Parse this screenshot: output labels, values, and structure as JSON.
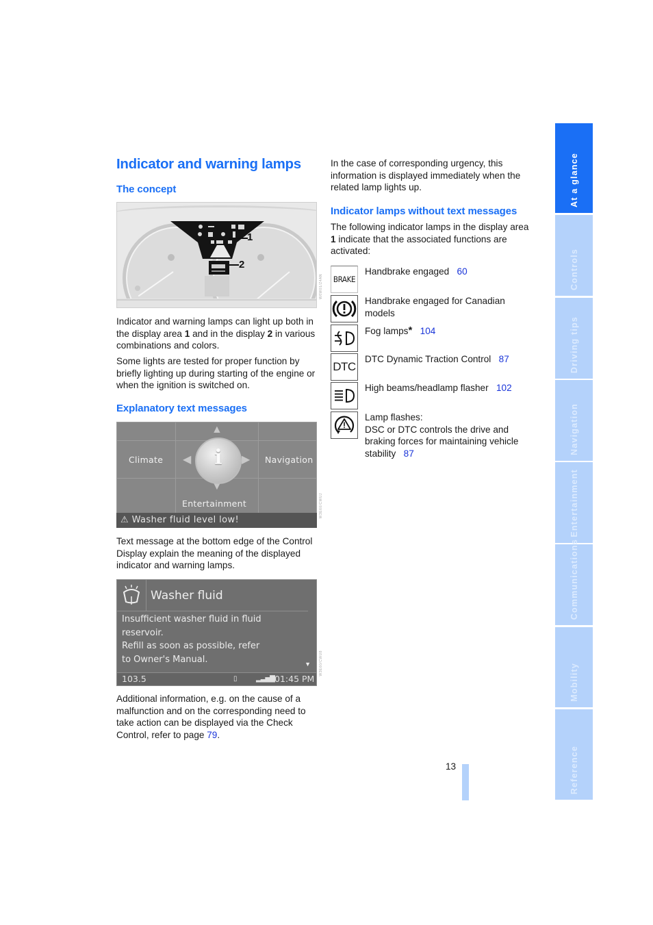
{
  "page": {
    "title": "Indicator and warning lamps",
    "page_number": "13",
    "accent_color": "#1a6ff5",
    "link_color": "#1a35d9",
    "tab_color_inactive": "#b4d2fb"
  },
  "left_column": {
    "concept_heading": "The concept",
    "cluster_figure": {
      "callout_1": "1",
      "callout_2": "2",
      "image_code": "W6W01/Z4AN"
    },
    "para1": {
      "part1": "Indicator and warning lamps can light up both in the display area ",
      "bold1": "1",
      "part2": " and in the display ",
      "bold2": "2",
      "part3": " in various combinations and colors."
    },
    "para2": "Some lights are tested for proper function by briefly lighting up during starting of the engine or when the ignition is switched on.",
    "explanatory_heading": "Explanatory text messages",
    "menu_figure": {
      "items": {
        "left": "Climate",
        "right": "Navigation",
        "bottom": "Entertainment"
      },
      "center_icon": "info-icon",
      "warning_message": "Washer fluid level low!",
      "image_code": "W3E60/CWUJ"
    },
    "para3": "Text message at the bottom edge of the Control Display explain the meaning of the displayed indicator and warning lamps.",
    "washer_figure": {
      "title": "Washer fluid",
      "lines": [
        "Insufficient washer fluid in fluid",
        "reservoir.",
        "Refill as soon as possible, refer",
        "to Owner's Manual."
      ],
      "status_frequency": "103.5",
      "status_time": "01:45 PM",
      "image_code": "W3E60/CWU8"
    },
    "para4": {
      "text": "Additional information, e.g. on the cause of a malfunction and on the corresponding need to take action can be displayed via the Check Control, refer to page ",
      "link": "79",
      "end": "."
    }
  },
  "right_column": {
    "para_urgency": "In the case of corresponding urgency, this information is displayed immediately when the related lamp lights up.",
    "indicator_heading": "Indicator lamps without text messages",
    "intro": {
      "part1": "The following indicator lamps in the display area ",
      "bold": "1",
      "part2": " indicate that the associated functions are activated:"
    },
    "indicators": [
      {
        "icon": "brake-text-icon",
        "icon_text": "BRAKE",
        "label": "Handbrake engaged",
        "page": "60"
      },
      {
        "icon": "handbrake-canada-icon",
        "label": "Handbrake engaged for Canadian models",
        "page": ""
      },
      {
        "icon": "fog-lamp-icon",
        "label": "Fog lamps",
        "asterisk": "*",
        "page": "104"
      },
      {
        "icon": "dtc-text-icon",
        "icon_text": "DTC",
        "label": "DTC Dynamic Traction Control",
        "page": "87"
      },
      {
        "icon": "high-beam-icon",
        "label": "High beams/headlamp flasher",
        "page": "102"
      },
      {
        "icon": "dsc-stability-icon",
        "label_line1": "Lamp flashes:",
        "label": "DSC or DTC controls the drive and braking forces for maintaining vehicle stability",
        "page": "87"
      }
    ]
  },
  "side_tabs": [
    {
      "label": "At a glance",
      "active": true
    },
    {
      "label": "Controls",
      "active": false
    },
    {
      "label": "Driving tips",
      "active": false
    },
    {
      "label": "Navigation",
      "active": false
    },
    {
      "label": "Entertainment",
      "active": false
    },
    {
      "label": "Communications",
      "active": false
    },
    {
      "label": "Mobility",
      "active": false
    },
    {
      "label": "Reference",
      "active": false
    }
  ]
}
